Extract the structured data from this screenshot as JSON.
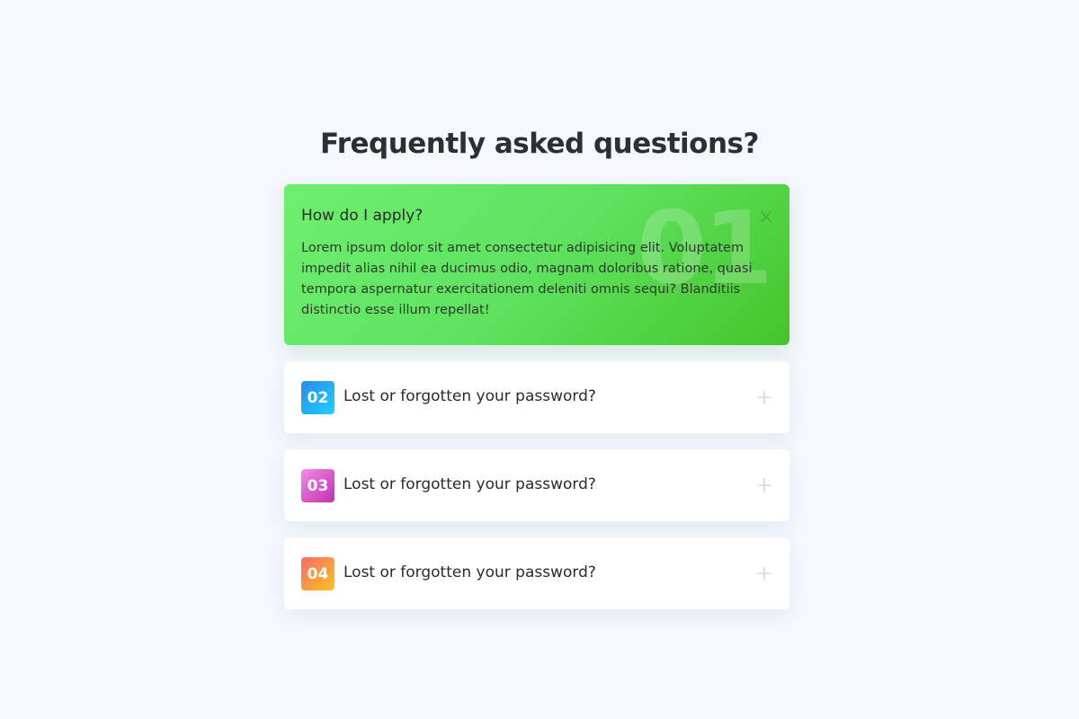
{
  "page": {
    "title": "Frequently asked questions?"
  },
  "faq": {
    "open_item": {
      "number": "01",
      "question": "How do I apply?",
      "answer": "Lorem ipsum dolor sit amet consectetur adipisicing elit. Voluptatem impedit alias nihil ea ducimus odio, magnam doloribus ratione, quasi tempora aspernatur exercitationem deleniti omnis sequi? Blanditiis distinctio esse illum repellat!",
      "icon": "close-icon"
    },
    "items": [
      {
        "number": "02",
        "question": "Lost or forgotten your password?",
        "icon": "plus-icon"
      },
      {
        "number": "03",
        "question": "Lost or forgotten your password?",
        "icon": "plus-icon"
      },
      {
        "number": "04",
        "question": "Lost or forgotten your password?",
        "icon": "plus-icon"
      }
    ]
  },
  "colors": {
    "page_background": "#f5f8fe",
    "open_gradient_start": "#6ef06e",
    "open_gradient_end": "#45c52b",
    "badge_02": "#2a8be8",
    "badge_03": "#c02fb0",
    "badge_04": "#f86a6a"
  }
}
